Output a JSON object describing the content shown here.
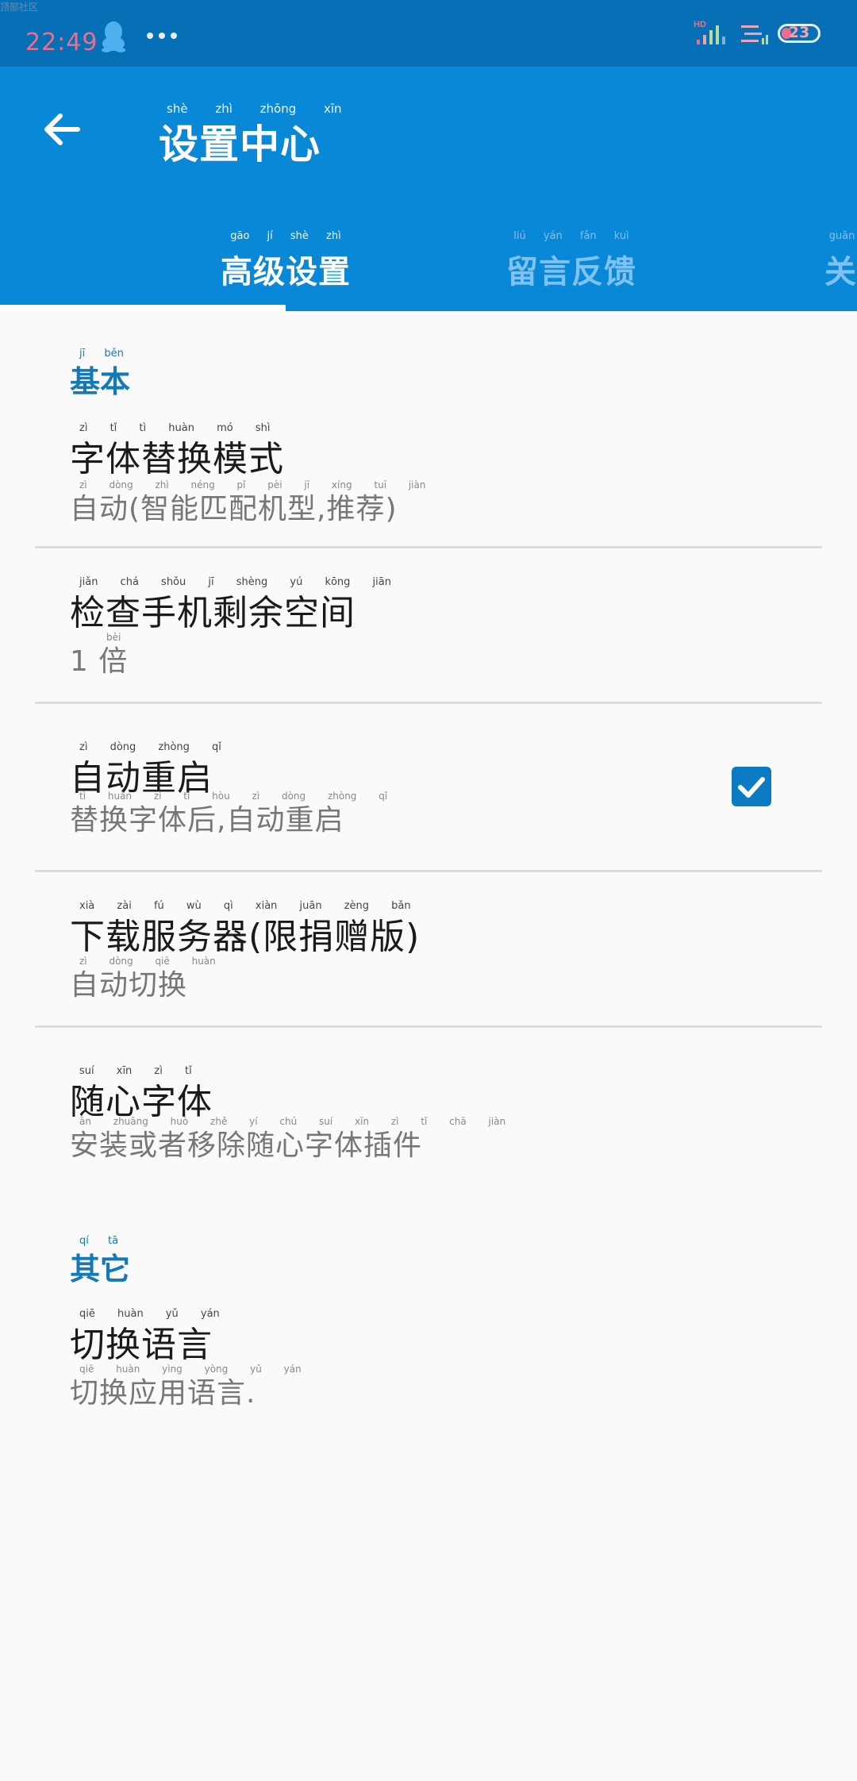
{
  "watermark": "顶部社区",
  "status_bar": {
    "time": "22:49",
    "icons": [
      "qq-icon",
      "more-dots-icon",
      "signal-hd-icon",
      "notification-icon"
    ],
    "battery_level": "23"
  },
  "app_bar": {
    "title": "设置中心",
    "title_pinyin": "shè zhì zhōng xīn"
  },
  "tabs": [
    {
      "label": "高级设置",
      "pinyin": "gāo jí shè zhì",
      "active": true
    },
    {
      "label": "留言反馈",
      "pinyin": "liú yán fǎn kuì",
      "active": false
    },
    {
      "label": "关于",
      "pinyin": "guān yú",
      "active": false
    }
  ],
  "sections": {
    "basic": {
      "title": "基本",
      "pinyin": "jī běn",
      "items": [
        {
          "title": "字体替换模式",
          "title_pinyin": "zì tǐ tì huàn mó shì",
          "summary": "自动(智能匹配机型,推荐)",
          "summary_pinyin": "zì dòng zhì néng pǐ pèi jī xíng tuī jiàn"
        },
        {
          "title": "检查手机剩余空间",
          "title_pinyin": "jiǎn chá shǒu jī shèng yú kōng jiān",
          "summary": "1 倍",
          "summary_pinyin": "bèi"
        },
        {
          "title": "自动重启",
          "title_pinyin": "zì dòng zhòng qǐ",
          "summary": "替换字体后,自动重启",
          "summary_pinyin": "tì huàn zì tǐ hòu zì dòng zhòng qǐ",
          "checked": true
        },
        {
          "title": "下载服务器(限捐赠版)",
          "title_pinyin": "xià zài fú wù qì xiàn juān zèng bǎn",
          "summary": "自动切换",
          "summary_pinyin": "zì dòng qiē huàn"
        },
        {
          "title": "随心字体",
          "title_pinyin": "suí xīn zì tǐ",
          "summary": "安装或者移除随心字体插件",
          "summary_pinyin": "ān zhuāng huò zhě yí chú suí xīn zì tǐ chā jiàn"
        }
      ]
    },
    "other": {
      "title": "其它",
      "pinyin": "qí tā",
      "items": [
        {
          "title": "切换语言",
          "title_pinyin": "qiē huàn yǔ yán",
          "summary": "切换应用语言.",
          "summary_pinyin": "qiē huàn yìng yòng yǔ yán"
        }
      ]
    }
  },
  "colors": {
    "status_bar": "#066fb5",
    "app_bar": "#0888d6",
    "accent": "#1479b8",
    "checkbox": "#0d7bc4"
  }
}
